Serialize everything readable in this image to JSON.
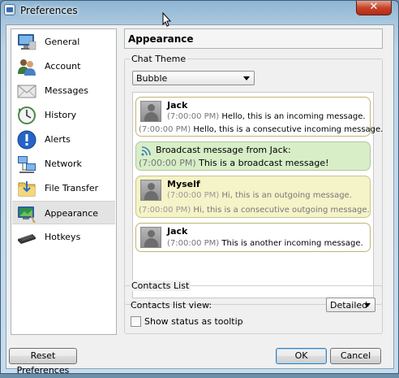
{
  "window": {
    "title": "Preferences",
    "close_glyph": "✕"
  },
  "sidebar": {
    "items": [
      {
        "label": "General",
        "icon": "monitor-icon"
      },
      {
        "label": "Account",
        "icon": "users-icon"
      },
      {
        "label": "Messages",
        "icon": "envelope-icon"
      },
      {
        "label": "History",
        "icon": "clock-icon"
      },
      {
        "label": "Alerts",
        "icon": "info-icon"
      },
      {
        "label": "Network",
        "icon": "network-icon"
      },
      {
        "label": "File Transfer",
        "icon": "folder-icon"
      },
      {
        "label": "Appearance",
        "icon": "appearance-icon"
      },
      {
        "label": "Hotkeys",
        "icon": "keyboard-icon"
      }
    ],
    "selected": "Appearance"
  },
  "panel": {
    "header": "Appearance",
    "chat_theme": {
      "group_label": "Chat Theme",
      "selected": "Bubble",
      "messages": [
        {
          "type": "incoming",
          "sender": "Jack",
          "lines": [
            {
              "time": "(7:00:00 PM)",
              "text": "Hello, this is an incoming message."
            },
            {
              "time": "(7:00:00 PM)",
              "text": "Hello, this is a consecutive incoming message."
            }
          ]
        },
        {
          "type": "broadcast",
          "title": "Broadcast message from Jack:",
          "time": "(7:00:00 PM)",
          "text": "This is a broadcast message!"
        },
        {
          "type": "outgoing",
          "sender": "Myself",
          "lines": [
            {
              "time": "(7:00:00 PM)",
              "text": "Hi, this is an outgoing message."
            },
            {
              "time": "(7:00:00 PM)",
              "text": "Hi, this is a consecutive outgoing message."
            }
          ]
        },
        {
          "type": "incoming",
          "sender": "Jack",
          "lines": [
            {
              "time": "(7:00:00 PM)",
              "text": "This is another incoming message."
            }
          ]
        }
      ]
    },
    "contacts_list": {
      "group_label": "Contacts List",
      "view_label": "Contacts list view:",
      "view_selected": "Detailed",
      "tooltip_checkbox_label": "Show status as tooltip",
      "tooltip_checked": false
    }
  },
  "footer": {
    "reset_label": "Reset Preferences",
    "ok_label": "OK",
    "cancel_label": "Cancel"
  }
}
